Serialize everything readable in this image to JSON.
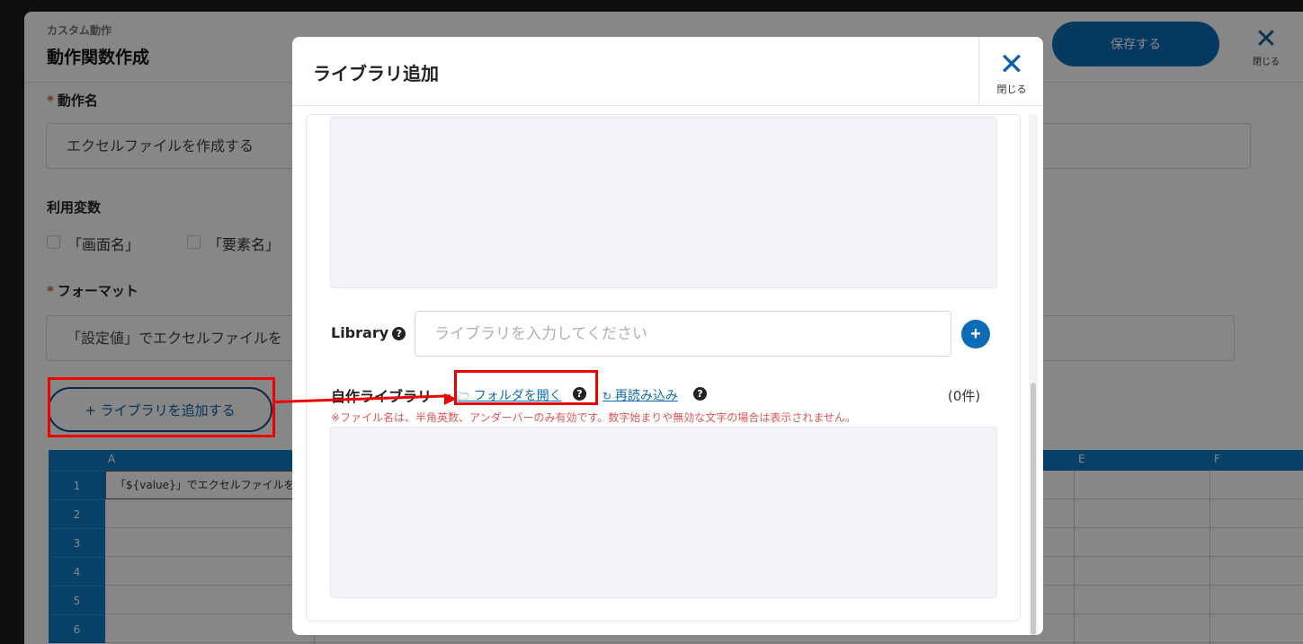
{
  "background": {
    "header_subtitle": "カスタム動作",
    "header_title": "動作関数作成",
    "save_label": "保存する",
    "close_label": "閉じる",
    "action_name_label": "動作名",
    "action_name_value": "エクセルファイルを作成する",
    "variables_label": "利用変数",
    "variables": [
      "「画面名」",
      "「要素名」"
    ],
    "format_label": "フォーマット",
    "format_value": "「設定値」でエクセルファイルを",
    "add_library_label": "+ ライブラリを追加する",
    "grid": {
      "columns": [
        "A",
        "E",
        "F"
      ],
      "rows": [
        "1",
        "2",
        "3",
        "4",
        "5",
        "6"
      ],
      "a1": "「${value}」でエクセルファイルを"
    }
  },
  "modal": {
    "title": "ライブラリ追加",
    "close_label": "閉じる",
    "library_label": "Library",
    "library_placeholder": "ライブラリを入力してください",
    "own_library_label": "自作ライブラリ",
    "open_folder_label": "フォルダを開く",
    "reload_label": "再読み込み",
    "count_label": "(0件)",
    "warning": "※ファイル名は、半角英数、アンダーバーのみ有効です。数字始まりや無効な文字の場合は表示されません。"
  },
  "colors": {
    "accent": "#0d6cb5",
    "highlight": "#ee0000",
    "warning": "#e05555"
  }
}
